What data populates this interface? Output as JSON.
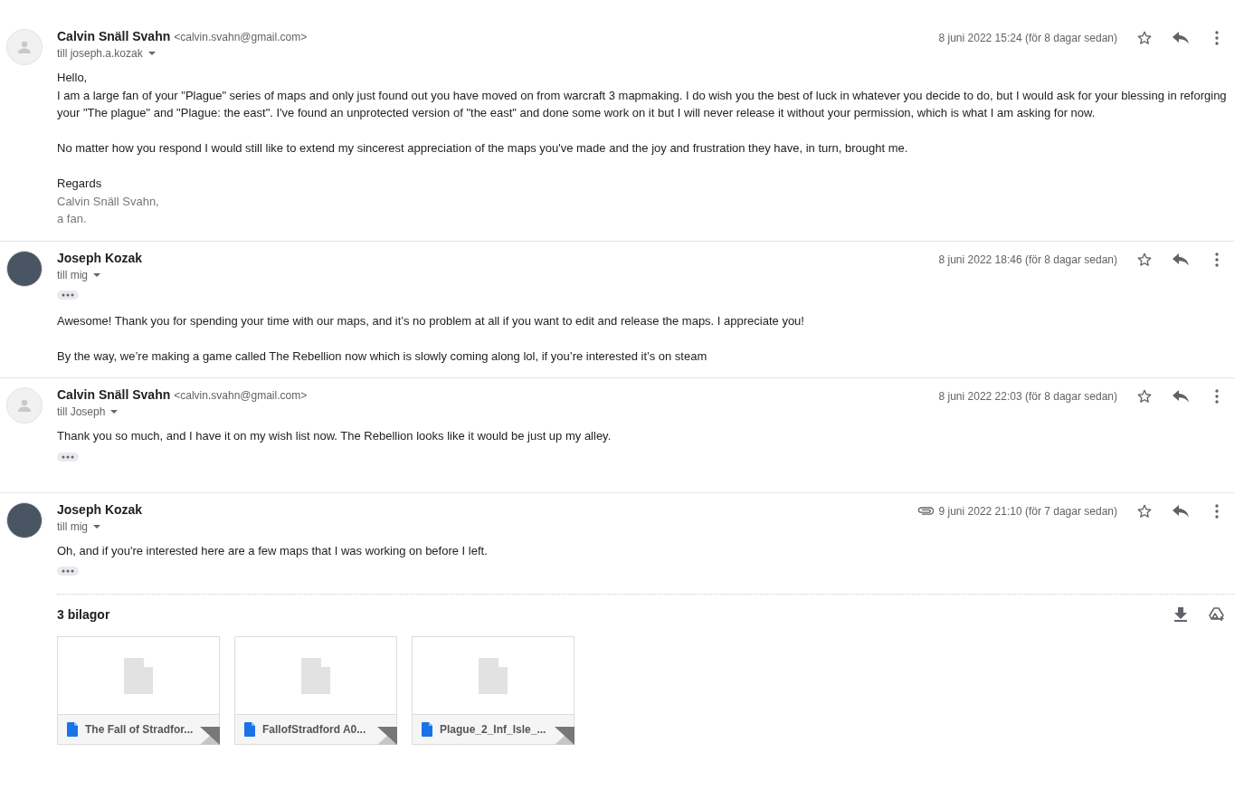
{
  "messages": [
    {
      "sender": "Calvin Snäll Svahn",
      "email": "<calvin.svahn@gmail.com>",
      "recipient": "till joseph.a.kozak",
      "date": "8 juni 2022 15:24 (för 8 dagar sedan)",
      "has_attachment": false,
      "has_photo": false,
      "starred": false,
      "body": [
        {
          "kind": "text",
          "lines": [
            "Hello,",
            "I am a large fan of your \"Plague\" series of maps and only just found out you have moved on from warcraft 3 mapmaking. I do wish you the best of luck in whatever you decide to do, but I would ask for your blessing in reforging your \"The plague\" and \"Plague: the east\". I've found an unprotected version of \"the east\" and done some work on it but I will never release it without your permission, which is what I am asking for now."
          ]
        },
        {
          "kind": "text",
          "lines": [
            "No matter how you respond I would still like to extend my sincerest appreciation of the maps you've made and the joy and frustration they have, in turn, brought me."
          ]
        },
        {
          "kind": "text",
          "lines": [
            "Regards"
          ]
        },
        {
          "kind": "signature",
          "lines": [
            "Calvin Snäll Svahn,",
            "a fan."
          ]
        }
      ]
    },
    {
      "sender": "Joseph Kozak",
      "recipient": "till mig",
      "date": "8 juni 2022 18:46 (för 8 dagar sedan)",
      "has_attachment": false,
      "has_photo": true,
      "starred": false,
      "body": [
        {
          "kind": "trimmed"
        },
        {
          "kind": "text",
          "lines": [
            "Awesome! Thank you for spending your time with our maps, and it’s no problem at all if you want to edit and release the maps. I appreciate you!"
          ]
        },
        {
          "kind": "text",
          "lines": [
            "By the way, we’re making a game called The Rebellion now which is slowly coming along lol, if you’re interested it’s on steam"
          ]
        }
      ]
    },
    {
      "sender": "Calvin Snäll Svahn",
      "email": "<calvin.svahn@gmail.com>",
      "recipient": "till Joseph",
      "date": "8 juni 2022 22:03 (för 8 dagar sedan)",
      "has_attachment": false,
      "has_photo": false,
      "starred": false,
      "body": [
        {
          "kind": "text",
          "lines": [
            "Thank you so much, and I have it on my wish list now. The Rebellion looks like it would be just up my alley."
          ]
        },
        {
          "kind": "trimmed"
        }
      ]
    },
    {
      "sender": "Joseph Kozak",
      "recipient": "till mig",
      "date": "9 juni 2022 21:10 (för 7 dagar sedan)",
      "has_attachment": true,
      "has_photo": true,
      "starred": false,
      "body": [
        {
          "kind": "text",
          "lines": [
            "Oh, and if you're interested here are a few maps that I was working on before I left."
          ]
        },
        {
          "kind": "trimmed"
        }
      ],
      "attachments": {
        "title": "3 bilagor",
        "files": [
          "The Fall of Stradfor...",
          "FallofStradford A0...",
          "Plague_2_Inf_Isle_..."
        ]
      }
    }
  ]
}
